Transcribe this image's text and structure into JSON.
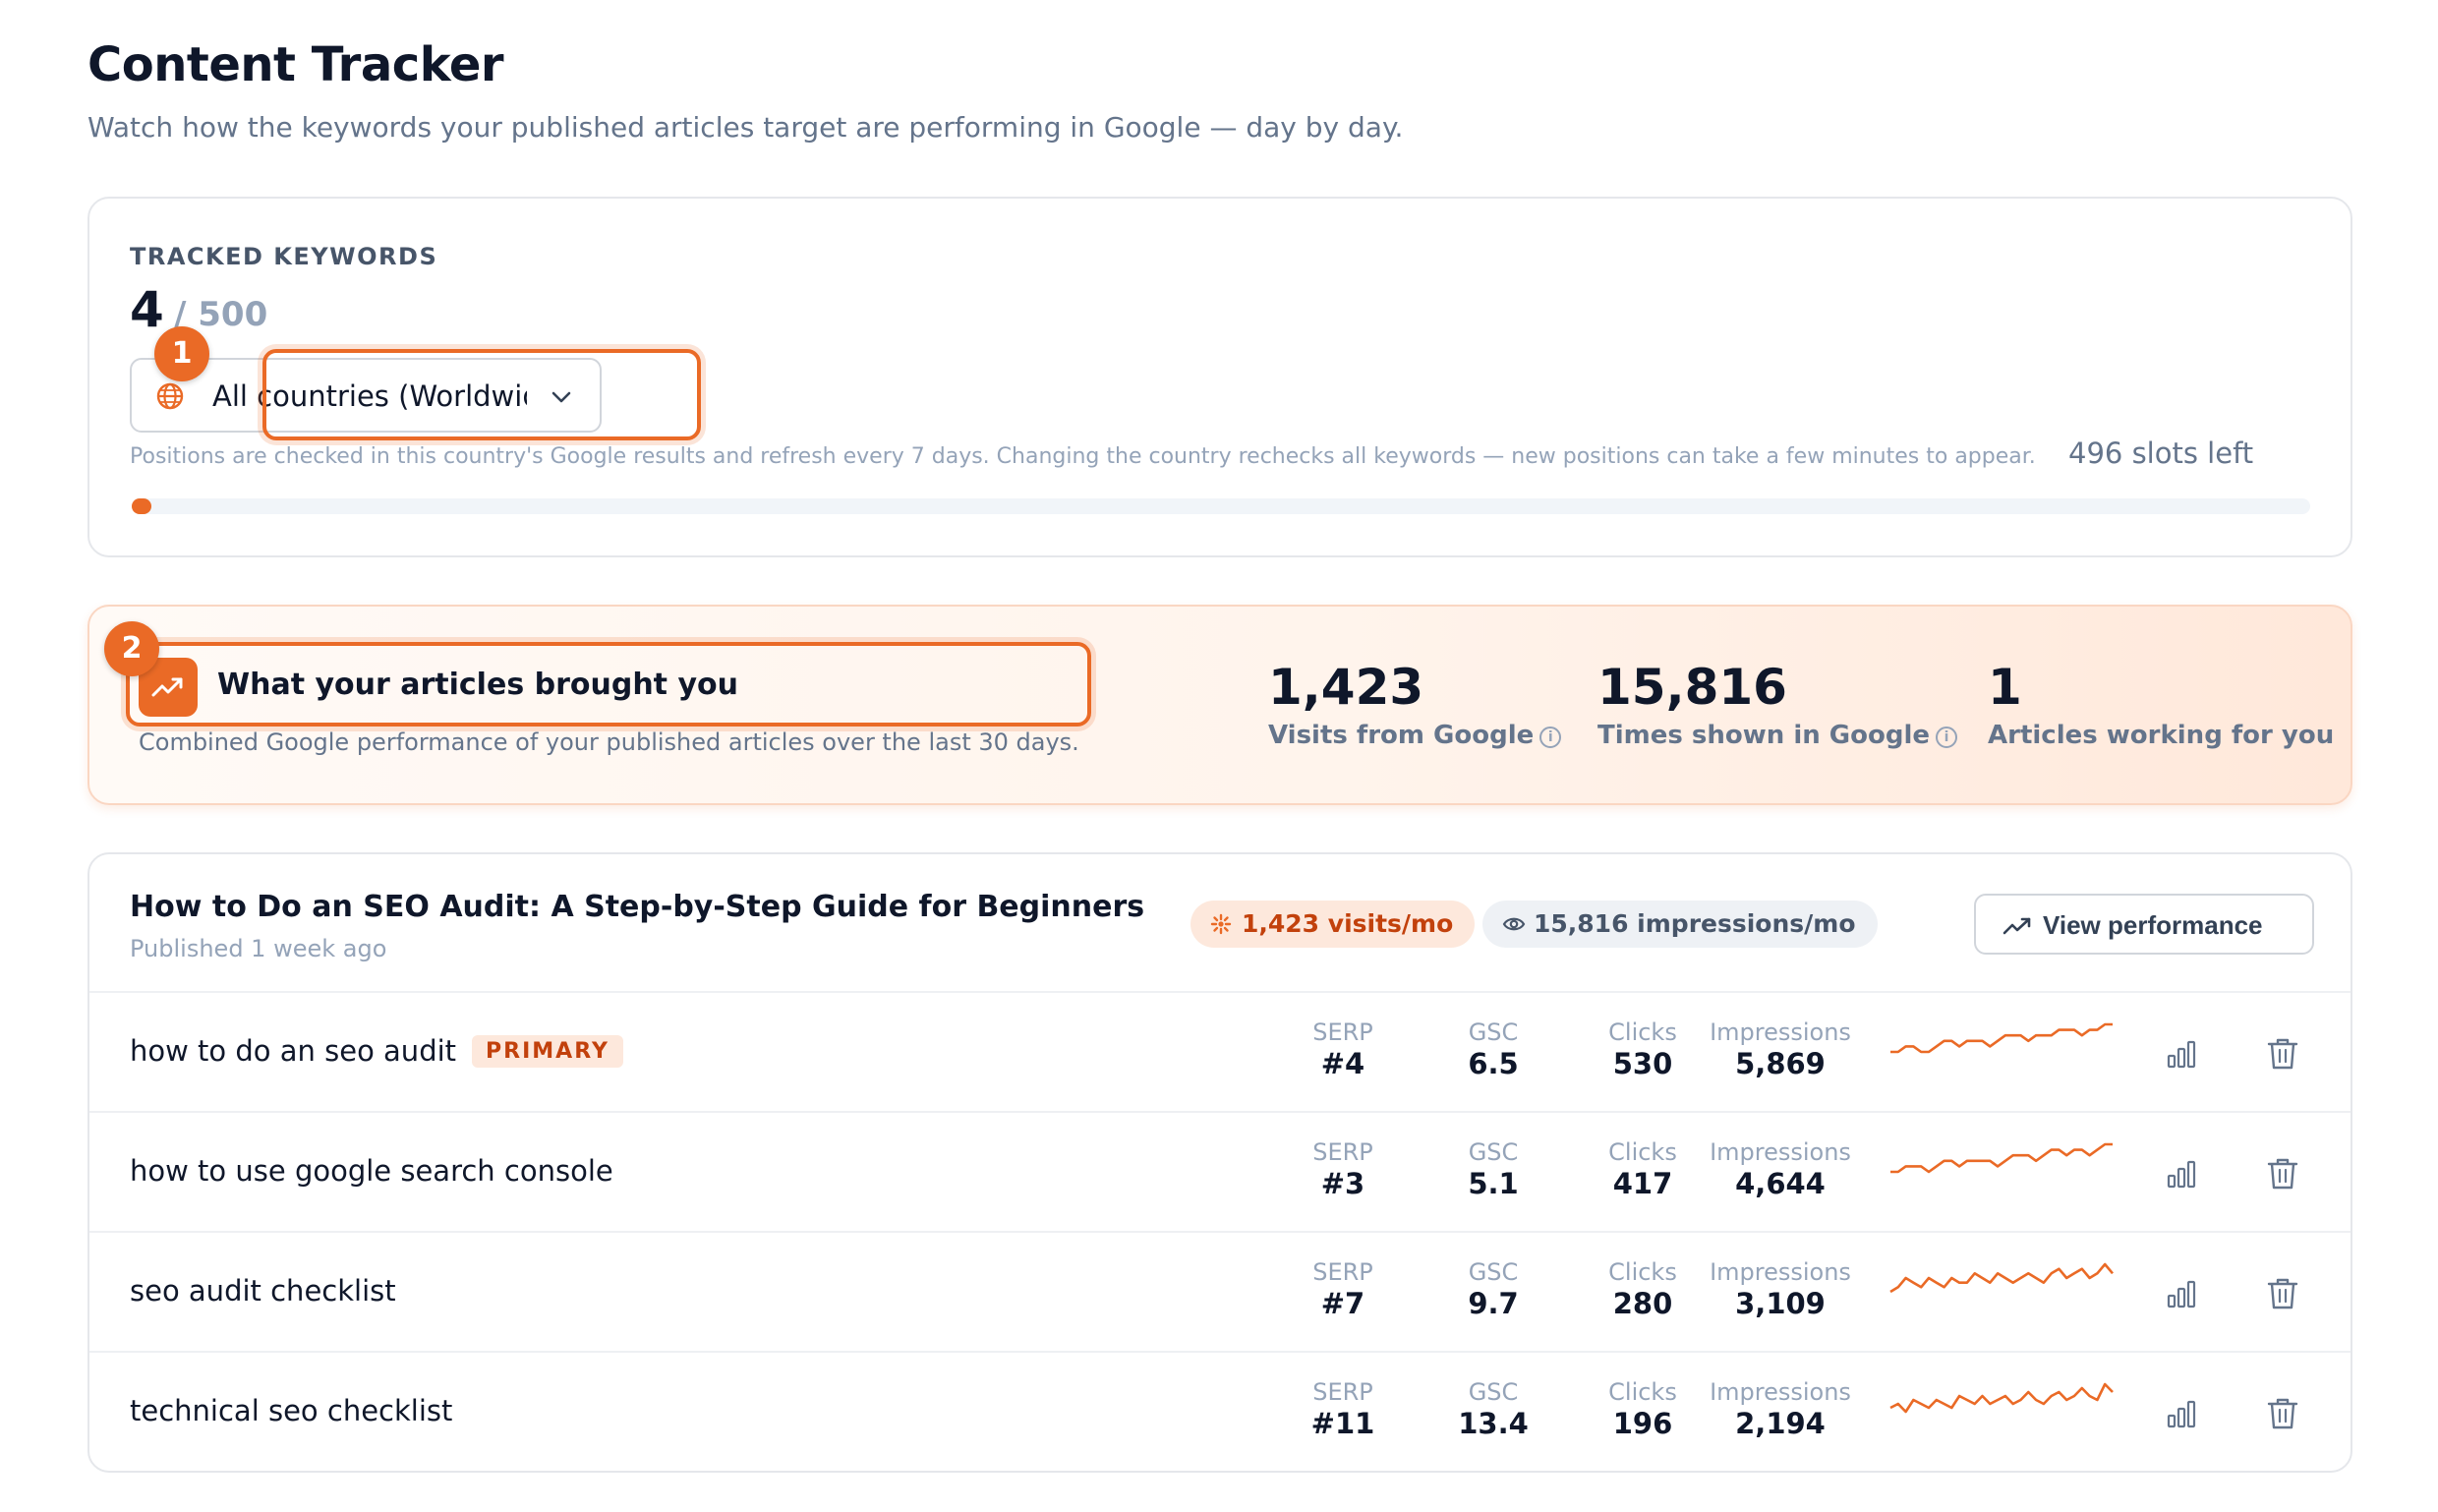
{
  "header": {
    "title": "Content Tracker",
    "subtitle": "Watch how the keywords your published articles target are performing in Google — day by day."
  },
  "tracked": {
    "label": "TRACKED KEYWORDS",
    "count": "4",
    "limit": "/ 500",
    "used_fraction": 0.008,
    "country": "All countries (Worldwide)",
    "hint": "Positions are checked in this country's Google results and refresh every 7 days. Changing the country rechecks all keywords — new positions can take a few minutes to appear.",
    "slots_left": "496 slots left",
    "badge": "1"
  },
  "summary": {
    "badge": "2",
    "title": "What your articles brought you",
    "subtitle": "Combined Google performance of your published articles over the last 30 days.",
    "stats": [
      {
        "value": "1,423",
        "label": "Visits from Google",
        "info": true
      },
      {
        "value": "15,816",
        "label": "Times shown in Google",
        "info": true
      },
      {
        "value": "1",
        "label": "Articles working for you",
        "info": false
      }
    ]
  },
  "article": {
    "title": "How to Do an SEO Audit: A Step-by-Step Guide for Beginners",
    "published": "Published 1 week ago",
    "visits": "1,423 visits/mo",
    "impressions": "15,816 impressions/mo",
    "view_button": "View performance",
    "metric_labels": {
      "serp": "SERP",
      "gsc": "GSC",
      "clicks": "Clicks",
      "impressions": "Impressions"
    },
    "keywords": [
      {
        "name": "how to do an seo audit",
        "tag": "PRIMARY",
        "serp": "#4",
        "gsc": "6.5",
        "clicks": "530",
        "impressions": "5,869",
        "trend": [
          3,
          3,
          4,
          4,
          3,
          3,
          4,
          5,
          5,
          4,
          5,
          5,
          5,
          4,
          5,
          6,
          6,
          6,
          5,
          6,
          6,
          6,
          7,
          7,
          7,
          6,
          7,
          7,
          8,
          8
        ]
      },
      {
        "name": "how to use google search console",
        "tag": "",
        "serp": "#3",
        "gsc": "5.1",
        "clicks": "417",
        "impressions": "4,644",
        "trend": [
          3,
          3,
          4,
          4,
          4,
          3,
          4,
          5,
          5,
          4,
          5,
          5,
          5,
          5,
          4,
          5,
          6,
          6,
          6,
          5,
          6,
          7,
          7,
          6,
          7,
          7,
          6,
          7,
          8,
          8
        ]
      },
      {
        "name": "seo audit checklist",
        "tag": "",
        "serp": "#7",
        "gsc": "9.7",
        "clicks": "280",
        "impressions": "3,109",
        "trend": [
          3,
          4,
          6,
          5,
          4,
          6,
          5,
          4,
          6,
          5,
          5,
          7,
          6,
          5,
          7,
          6,
          5,
          6,
          7,
          6,
          5,
          7,
          8,
          6,
          7,
          8,
          6,
          7,
          9,
          7
        ]
      },
      {
        "name": "technical seo checklist",
        "tag": "",
        "serp": "#11",
        "gsc": "13.4",
        "clicks": "196",
        "impressions": "2,194",
        "trend": [
          3,
          4,
          2,
          5,
          4,
          3,
          5,
          4,
          3,
          6,
          5,
          4,
          6,
          4,
          5,
          6,
          4,
          5,
          7,
          5,
          4,
          6,
          7,
          5,
          6,
          8,
          6,
          5,
          9,
          7
        ]
      }
    ]
  },
  "colors": {
    "accent": "#ea6a26",
    "accent_soft": "#fde8dc",
    "text": "#0f172a",
    "muted": "#64748b"
  }
}
